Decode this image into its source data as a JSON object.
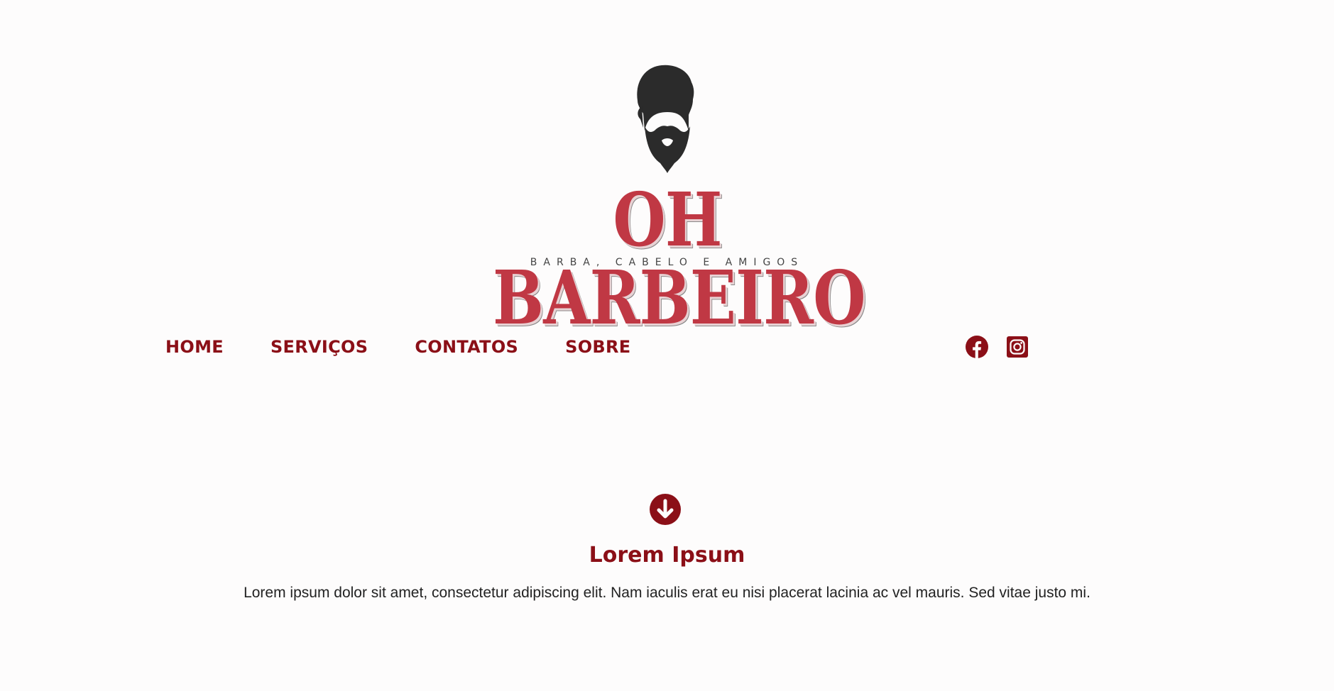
{
  "brand": {
    "name": "OH BARBEIRO",
    "tagline": "BARBA, CABELO E AMIGOS",
    "logo_icon": "bearded-man-icon"
  },
  "nav": {
    "items": [
      {
        "label": "HOME"
      },
      {
        "label": "SERVIÇOS"
      },
      {
        "label": "CONTATOS"
      },
      {
        "label": "SOBRE"
      }
    ]
  },
  "social": {
    "facebook_icon": "facebook-icon",
    "instagram_icon": "instagram-icon"
  },
  "section": {
    "icon": "arrow-down-circle-icon",
    "title": "Lorem Ipsum",
    "text": "Lorem ipsum dolor sit amet, consectetur adipiscing elit. Nam iaculis erat eu nisi placerat lacinia ac vel mauris. Sed vitae justo mi."
  },
  "colors": {
    "accent": "#8b0f17",
    "logo_red": "#c03844",
    "background": "#fdfcfc",
    "text": "#222222"
  }
}
